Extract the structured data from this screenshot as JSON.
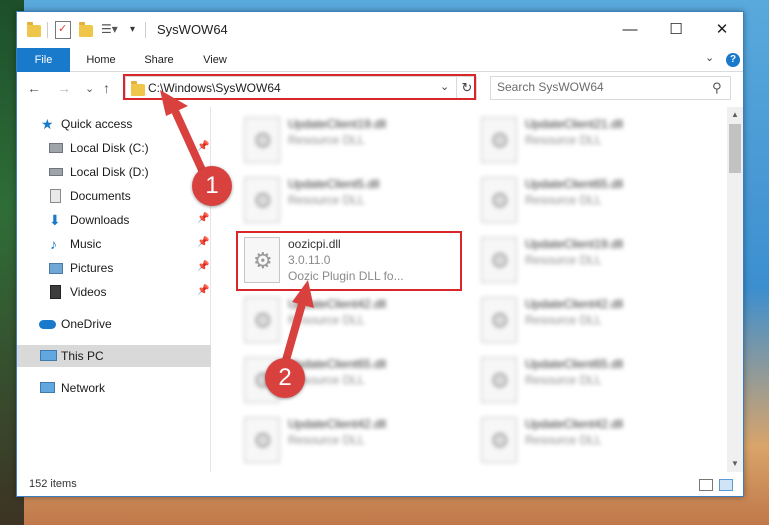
{
  "window": {
    "title": "SysWOW64",
    "controls": {
      "minimize": "—",
      "maximize": "☐",
      "close": "✕"
    }
  },
  "ribbon": {
    "tabs": [
      {
        "label": "File"
      },
      {
        "label": "Home"
      },
      {
        "label": "Share"
      },
      {
        "label": "View"
      }
    ],
    "expand_glyph": "⌄",
    "help_glyph": "?"
  },
  "nav": {
    "back": "←",
    "forward": "→",
    "recent": "⌄",
    "up": "↑",
    "address": "C:\\Windows\\SysWOW64",
    "address_dropdown": "⌄",
    "refresh": "↻",
    "search_placeholder": "Search SysWOW64",
    "search_icon": "⚲"
  },
  "sidebar": {
    "items": [
      {
        "label": "Quick access",
        "icon": "star-icon",
        "pinned": false
      },
      {
        "label": "Local Disk (C:)",
        "icon": "drive-icon",
        "pinned": true
      },
      {
        "label": "Local Disk (D:)",
        "icon": "drive-icon",
        "pinned": false
      },
      {
        "label": "Documents",
        "icon": "documents-icon",
        "pinned": true
      },
      {
        "label": "Downloads",
        "icon": "downloads-icon",
        "pinned": true
      },
      {
        "label": "Music",
        "icon": "music-icon",
        "pinned": true
      },
      {
        "label": "Pictures",
        "icon": "pictures-icon",
        "pinned": true
      },
      {
        "label": "Videos",
        "icon": "videos-icon",
        "pinned": true
      },
      {
        "label": "OneDrive",
        "icon": "onedrive-icon",
        "pinned": false
      },
      {
        "label": "This PC",
        "icon": "pc-icon",
        "pinned": false,
        "selected": true
      },
      {
        "label": "Network",
        "icon": "network-icon",
        "pinned": false
      }
    ],
    "pin_glyph": "📌"
  },
  "files": [
    {
      "name": "UpdateClient19.dll",
      "type": "Resource DLL"
    },
    {
      "name": "UpdateClient21.dll",
      "type": "Resource DLL"
    },
    {
      "name": "UpdateClient5.dll",
      "type": "Resource DLL"
    },
    {
      "name": "UpdateClient65.dll",
      "type": "Resource DLL"
    },
    {
      "name": "UpdateClient19.dll",
      "type": "Resource DLL"
    },
    {
      "name": "UpdateClient42.dll",
      "type": "Resource DLL"
    },
    {
      "name": "UpdateClient42.dll",
      "type": "Resource DLL"
    },
    {
      "name": "UpdateClient65.dll",
      "type": "Resource DLL"
    },
    {
      "name": "UpdateClient65.dll",
      "type": "Resource DLL"
    },
    {
      "name": "UpdateClient42.dll",
      "type": "Resource DLL"
    },
    {
      "name": "UpdateClient42.dll",
      "type": "Resource DLL"
    }
  ],
  "highlighted_file": {
    "name": "oozicpi.dll",
    "version": "3.0.11.0",
    "description": "Oozic Plugin DLL fo..."
  },
  "status": {
    "count": "152 items"
  },
  "callouts": [
    "1",
    "2"
  ],
  "colors": {
    "accent": "#1979ca",
    "annotation": "#d9413f"
  }
}
